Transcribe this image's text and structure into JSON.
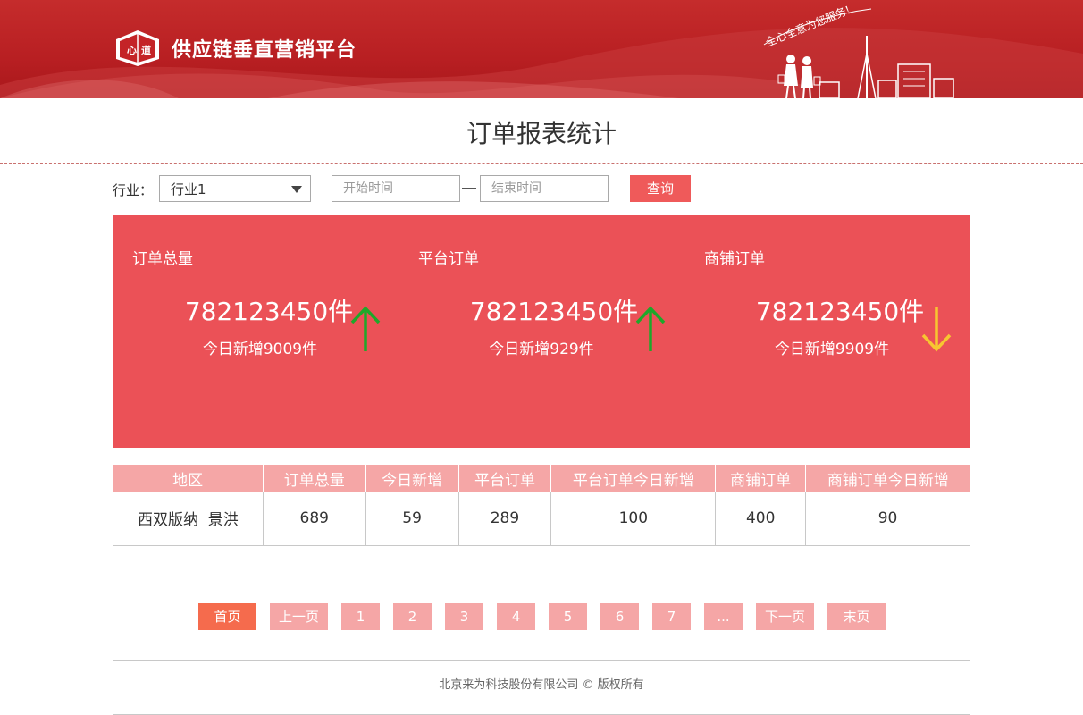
{
  "header": {
    "brand": "供应链垂直营销平台",
    "slogan": "全心全意为您服务!",
    "logo_glyph": "心"
  },
  "page_title": "订单报表统计",
  "filter": {
    "industry_label": "行业：",
    "industry_value": "行业1",
    "start_placeholder": "开始时间",
    "end_placeholder": "结束时间",
    "query_label": "查询"
  },
  "stats": [
    {
      "title": "订单总量",
      "value": "782123450件",
      "today": "今日新增9009件",
      "trend": "up"
    },
    {
      "title": "平台订单",
      "value": "782123450件",
      "today": "今日新增929件",
      "trend": "up"
    },
    {
      "title": "商铺订单",
      "value": "782123450件",
      "today": "今日新增9909件",
      "trend": "down"
    }
  ],
  "table": {
    "headers": [
      "地区",
      "订单总量",
      "今日新增",
      "平台订单",
      "平台订单今日新增",
      "商铺订单",
      "商铺订单今日新增"
    ],
    "rows": [
      [
        "西双版纳  景洪",
        "689",
        "59",
        "289",
        "100",
        "400",
        "90"
      ]
    ]
  },
  "pagination": [
    "首页",
    "上一页",
    "1",
    "2",
    "3",
    "4",
    "5",
    "6",
    "7",
    "...",
    "下一页",
    "末页"
  ],
  "footer": "北京来为科技股份有限公司 ©  版权所有",
  "colors": {
    "banner": "#b81f22",
    "panel": "#eb5157",
    "header_cell": "#f5a6a6",
    "active_page": "#f56b4d",
    "arrow_up": "#1ea82a",
    "arrow_down": "#f7c531"
  }
}
